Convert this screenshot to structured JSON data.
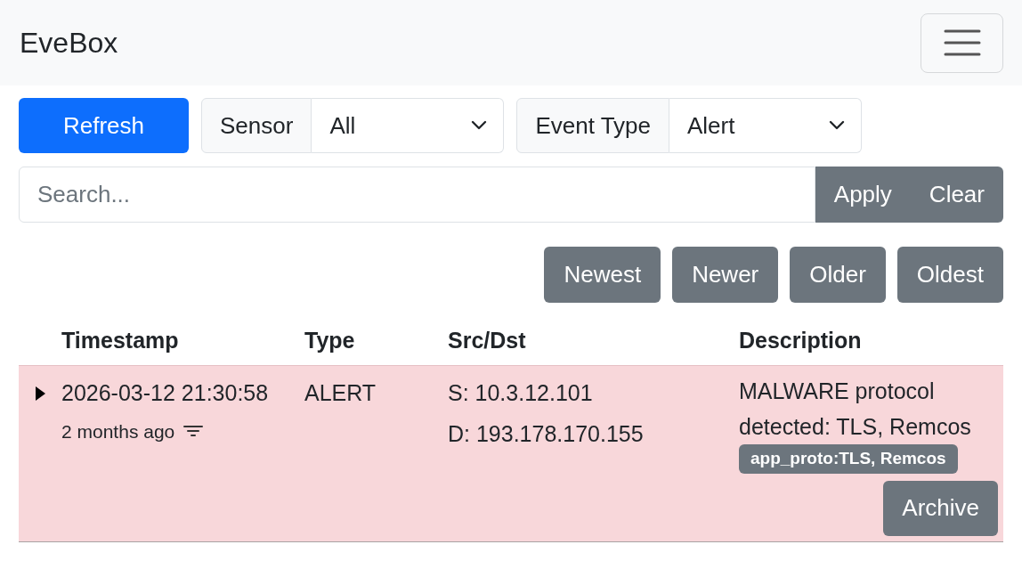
{
  "navbar": {
    "brand": "EveBox"
  },
  "toolbar": {
    "refresh": "Refresh",
    "filters": [
      {
        "label": "Sensor",
        "value": "All"
      },
      {
        "label": "Event Type",
        "value": "Alert"
      }
    ]
  },
  "search": {
    "placeholder": "Search...",
    "buttons": [
      "Apply",
      "Clear"
    ]
  },
  "pager": [
    "Newest",
    "Newer",
    "Older",
    "Oldest"
  ],
  "table": {
    "columns": [
      "Timestamp",
      "Type",
      "Src/Dst",
      "Description"
    ],
    "rows": [
      {
        "expanded": false,
        "timestamp": "2026-03-12 21:30:58",
        "relative": "2 months ago",
        "type": "ALERT",
        "src": "S: 10.3.12.101",
        "dst": "D: 193.178.170.155",
        "description": "MALWARE protocol detected: TLS, Remcos",
        "tag": "app_proto:TLS, Remcos",
        "action": "Archive"
      }
    ]
  }
}
